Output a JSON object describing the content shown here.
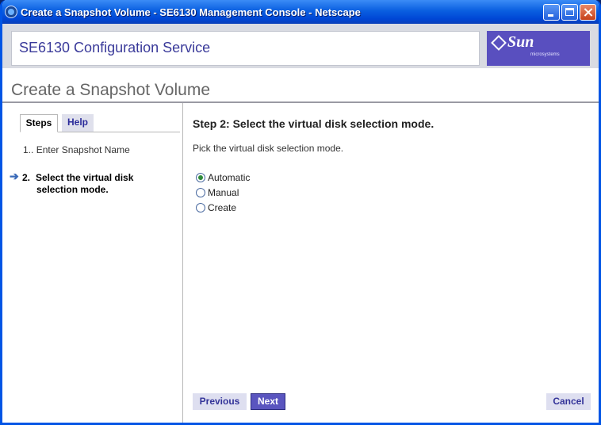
{
  "window": {
    "title": "Create a Snapshot Volume - SE6130 Management Console - Netscape"
  },
  "masthead": {
    "app_name": "SE6130 Configuration Service",
    "logo_text": "Sun",
    "logo_subtext": "microsystems"
  },
  "page": {
    "title": "Create a Snapshot Volume"
  },
  "tabs": [
    {
      "label": "Steps",
      "selected": true
    },
    {
      "label": "Help",
      "selected": false
    }
  ],
  "steps": [
    {
      "number": "1..",
      "label": "Enter Snapshot Name",
      "current": false
    },
    {
      "number": "2.",
      "label_line1": "Select the virtual disk",
      "label_line2": "selection mode.",
      "current": true
    }
  ],
  "main": {
    "heading": "Step 2:  Select the virtual disk selection mode.",
    "instructions": "Pick the virtual disk selection mode.",
    "options": [
      {
        "label": "Automatic",
        "checked": true
      },
      {
        "label": "Manual",
        "checked": false
      },
      {
        "label": "Create",
        "checked": false
      }
    ]
  },
  "buttons": {
    "previous": "Previous",
    "next": "Next",
    "cancel": "Cancel"
  },
  "colors": {
    "titlebar": "#0a5fe0",
    "brand_text": "#3a3a9a",
    "sun_logo_bg": "#594fbf",
    "next_button": "#5a55bf"
  }
}
